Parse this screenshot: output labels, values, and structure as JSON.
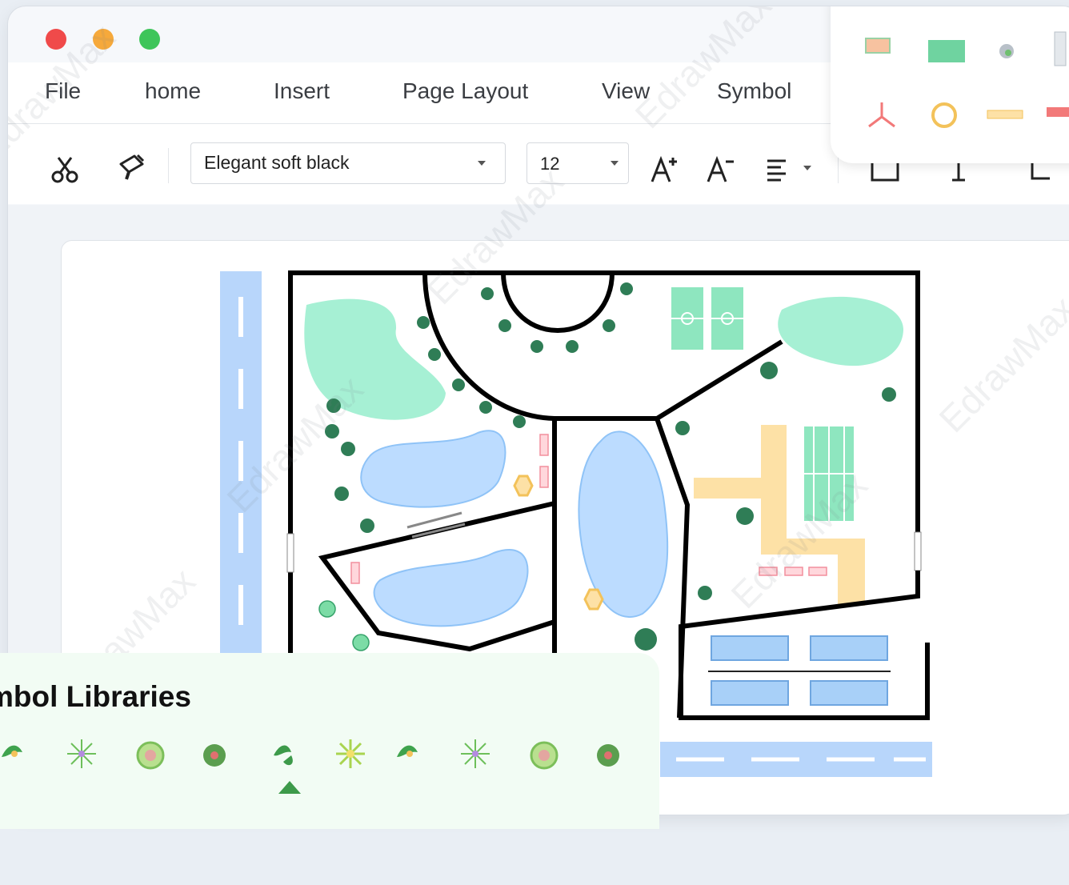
{
  "menu": {
    "items": [
      "File",
      "home",
      "Insert",
      "Page Layout",
      "View",
      "Symbol"
    ]
  },
  "toolbar": {
    "font_name": "Elegant soft black",
    "font_size": "12"
  },
  "symbol_panel": {
    "title": "mbol Libraries"
  },
  "watermark": "EdrawMax",
  "colors": {
    "lawn": "#a6f0d4",
    "water": "#bcdcff",
    "road": "#b8d6fb",
    "path": "#fde1a6",
    "field": "#8ee6bf",
    "car": "#8fc3f7",
    "boundary": "#000000"
  }
}
